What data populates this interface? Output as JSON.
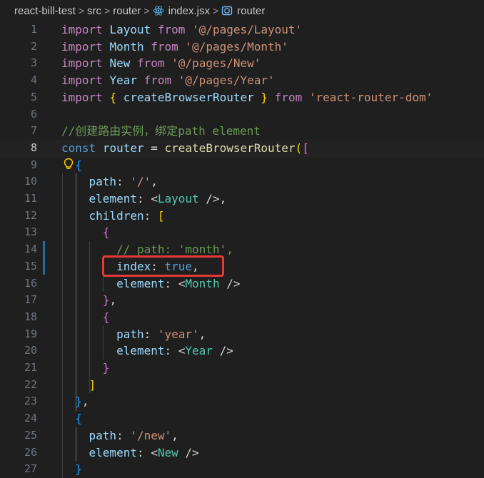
{
  "breadcrumb": {
    "items": [
      "react-bill-test",
      "src",
      "router",
      "index.jsx",
      "router"
    ],
    "separator": ">"
  },
  "colors": {
    "keyword": "#c586c0",
    "string": "#ce9178",
    "variable": "#9cdcfe",
    "function": "#dcdcaa",
    "comment": "#6a9955",
    "tag": "#4ec9b0",
    "highlight_box": "#e53935"
  },
  "editor": {
    "current_line": 8,
    "lines": [
      {
        "n": "1",
        "t": [
          [
            "kw",
            "import"
          ],
          [
            "pn",
            " "
          ],
          [
            "vr",
            "Layout"
          ],
          [
            "pn",
            " "
          ],
          [
            "kw",
            "from"
          ],
          [
            "pn",
            " "
          ],
          [
            "st",
            "'@/pages/Layout'"
          ]
        ]
      },
      {
        "n": "2",
        "t": [
          [
            "kw",
            "import"
          ],
          [
            "pn",
            " "
          ],
          [
            "vr",
            "Month"
          ],
          [
            "pn",
            " "
          ],
          [
            "kw",
            "from"
          ],
          [
            "pn",
            " "
          ],
          [
            "st",
            "'@/pages/Month'"
          ]
        ]
      },
      {
        "n": "3",
        "t": [
          [
            "kw",
            "import"
          ],
          [
            "pn",
            " "
          ],
          [
            "vr",
            "New"
          ],
          [
            "pn",
            " "
          ],
          [
            "kw",
            "from"
          ],
          [
            "pn",
            " "
          ],
          [
            "st",
            "'@/pages/New'"
          ]
        ]
      },
      {
        "n": "4",
        "t": [
          [
            "kw",
            "import"
          ],
          [
            "pn",
            " "
          ],
          [
            "vr",
            "Year"
          ],
          [
            "pn",
            " "
          ],
          [
            "kw",
            "from"
          ],
          [
            "pn",
            " "
          ],
          [
            "st",
            "'@/pages/Year'"
          ]
        ]
      },
      {
        "n": "5",
        "t": [
          [
            "kw",
            "import"
          ],
          [
            "pn",
            " "
          ],
          [
            "by",
            "{"
          ],
          [
            "pn",
            " "
          ],
          [
            "vr",
            "createBrowserRouter"
          ],
          [
            "pn",
            " "
          ],
          [
            "by",
            "}"
          ],
          [
            "pn",
            " "
          ],
          [
            "kw",
            "from"
          ],
          [
            "pn",
            " "
          ],
          [
            "st",
            "'react-router-dom'"
          ]
        ]
      },
      {
        "n": "6",
        "t": []
      },
      {
        "n": "7",
        "t": [
          [
            "cm",
            "//创建路由实例，绑定path element"
          ]
        ]
      },
      {
        "n": "8",
        "t": [
          [
            "bl",
            "const"
          ],
          [
            "pn",
            " "
          ],
          [
            "vr",
            "router"
          ],
          [
            "pn",
            " = "
          ],
          [
            "fn",
            "createBrowserRouter"
          ],
          [
            "by",
            "("
          ],
          [
            "bm",
            "["
          ]
        ]
      },
      {
        "n": "9",
        "t": [
          [
            "pn",
            "  "
          ],
          [
            "bb",
            "{"
          ]
        ]
      },
      {
        "n": "10",
        "t": [
          [
            "pn",
            "    "
          ],
          [
            "vr",
            "path"
          ],
          [
            "pn",
            ": "
          ],
          [
            "st",
            "'/'"
          ],
          [
            "pn",
            ","
          ]
        ]
      },
      {
        "n": "11",
        "t": [
          [
            "pn",
            "    "
          ],
          [
            "vr",
            "element"
          ],
          [
            "pn",
            ": "
          ],
          [
            "pn",
            "<"
          ],
          [
            "tg",
            "Layout"
          ],
          [
            "pn",
            " />,"
          ]
        ]
      },
      {
        "n": "12",
        "t": [
          [
            "pn",
            "    "
          ],
          [
            "vr",
            "children"
          ],
          [
            "pn",
            ": "
          ],
          [
            "by",
            "["
          ]
        ]
      },
      {
        "n": "13",
        "t": [
          [
            "pn",
            "      "
          ],
          [
            "bm",
            "{"
          ]
        ]
      },
      {
        "n": "14",
        "t": [
          [
            "pn",
            "        "
          ],
          [
            "cm",
            "// path: 'month',"
          ]
        ]
      },
      {
        "n": "15",
        "t": [
          [
            "pn",
            "        "
          ],
          [
            "vr",
            "index"
          ],
          [
            "pn",
            ": "
          ],
          [
            "bl",
            "true"
          ],
          [
            "pn",
            ","
          ]
        ]
      },
      {
        "n": "16",
        "t": [
          [
            "pn",
            "        "
          ],
          [
            "vr",
            "element"
          ],
          [
            "pn",
            ": "
          ],
          [
            "pn",
            "<"
          ],
          [
            "tg",
            "Month"
          ],
          [
            "pn",
            " />"
          ]
        ]
      },
      {
        "n": "17",
        "t": [
          [
            "pn",
            "      "
          ],
          [
            "bm",
            "}"
          ],
          [
            "pn",
            ","
          ]
        ]
      },
      {
        "n": "18",
        "t": [
          [
            "pn",
            "      "
          ],
          [
            "bm",
            "{"
          ]
        ]
      },
      {
        "n": "19",
        "t": [
          [
            "pn",
            "        "
          ],
          [
            "vr",
            "path"
          ],
          [
            "pn",
            ": "
          ],
          [
            "st",
            "'year'"
          ],
          [
            "pn",
            ","
          ]
        ]
      },
      {
        "n": "20",
        "t": [
          [
            "pn",
            "        "
          ],
          [
            "vr",
            "element"
          ],
          [
            "pn",
            ": "
          ],
          [
            "pn",
            "<"
          ],
          [
            "tg",
            "Year"
          ],
          [
            "pn",
            " />"
          ]
        ]
      },
      {
        "n": "21",
        "t": [
          [
            "pn",
            "      "
          ],
          [
            "bm",
            "}"
          ]
        ]
      },
      {
        "n": "22",
        "t": [
          [
            "pn",
            "    "
          ],
          [
            "by",
            "]"
          ]
        ]
      },
      {
        "n": "23",
        "t": [
          [
            "pn",
            "  "
          ],
          [
            "bb",
            "}"
          ],
          [
            "pn",
            ","
          ]
        ]
      },
      {
        "n": "24",
        "t": [
          [
            "pn",
            "  "
          ],
          [
            "bb",
            "{"
          ]
        ]
      },
      {
        "n": "25",
        "t": [
          [
            "pn",
            "    "
          ],
          [
            "vr",
            "path"
          ],
          [
            "pn",
            ": "
          ],
          [
            "st",
            "'/new'"
          ],
          [
            "pn",
            ","
          ]
        ]
      },
      {
        "n": "26",
        "t": [
          [
            "pn",
            "    "
          ],
          [
            "vr",
            "element"
          ],
          [
            "pn",
            ": "
          ],
          [
            "pn",
            "<"
          ],
          [
            "tg",
            "New"
          ],
          [
            "pn",
            " />"
          ]
        ]
      },
      {
        "n": "27",
        "t": [
          [
            "pn",
            "  "
          ],
          [
            "bb",
            "}"
          ]
        ]
      }
    ]
  }
}
